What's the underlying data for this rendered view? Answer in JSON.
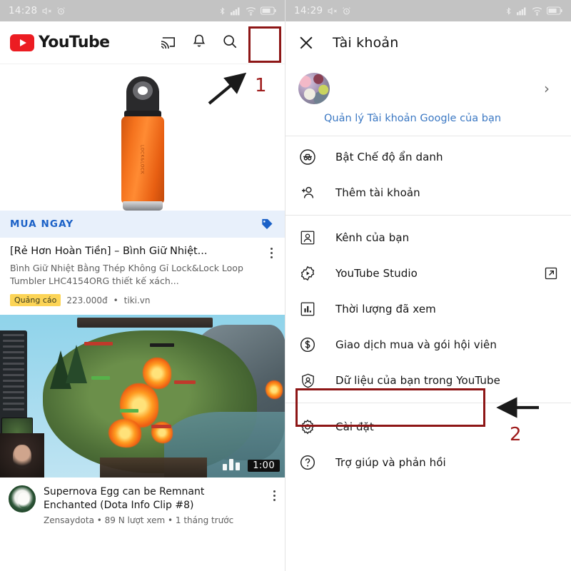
{
  "left_phone": {
    "status_bar": {
      "time": "14:28",
      "icons": [
        "mute-icon",
        "alarm-icon",
        "bluetooth-icon",
        "signal-icon",
        "wifi-icon",
        "battery-icon"
      ]
    },
    "app_bar": {
      "brand": "YouTube",
      "actions": [
        "cast-icon",
        "bell-icon",
        "search-icon",
        "account-avatar"
      ]
    },
    "ad_card": {
      "buy_label": "MUA NGAY",
      "tag_icon": "price-tag-icon",
      "title": "[Rẻ Hơn Hoàn Tiền] – Bình Giữ Nhiệt...",
      "description": "Bình Giữ Nhiệt Bằng Thép Không Gỉ Lock&Lock Loop Tumbler LHC4154ORG thiết kế xách...",
      "ad_badge": "Quảng cáo",
      "price": "223.000đ",
      "source": "tiki.vn",
      "separator": "•",
      "product_image": "orange-thermos-bottle"
    },
    "video_card": {
      "duration": "1:00",
      "thumbnail": "dota2-gameplay-thumbnail",
      "title": "Supernova Egg can be Remnant Enchanted (Dota Info Clip #8)",
      "channel": "Zensaydota",
      "views": "89 N lượt xem",
      "age": "1 tháng trước",
      "separator": "•"
    }
  },
  "right_phone": {
    "status_bar": {
      "time": "14:29",
      "icons": [
        "mute-icon",
        "alarm-icon",
        "bluetooth-icon",
        "signal-icon",
        "wifi-icon",
        "battery-icon"
      ]
    },
    "sheet": {
      "close_icon": "close-icon",
      "title": "Tài khoản",
      "manage_link": "Quản lý Tài khoản Google của bạn",
      "chevron": "›",
      "account_name_blurred": "",
      "account_email_blurred": ""
    },
    "menu_items": [
      {
        "label": "Bật Chế độ ẩn danh",
        "icon": "incognito-icon",
        "trailing": ""
      },
      {
        "label": "Thêm tài khoản",
        "icon": "add-person-icon",
        "trailing": ""
      },
      {
        "label": "Kênh của bạn",
        "icon": "channel-icon",
        "trailing": ""
      },
      {
        "label": "YouTube Studio",
        "icon": "studio-gear-icon",
        "trailing": "external-link-icon"
      },
      {
        "label": "Thời lượng đã xem",
        "icon": "bar-chart-icon",
        "trailing": ""
      },
      {
        "label": "Giao dịch mua và gói hội viên",
        "icon": "dollar-circle-icon",
        "trailing": ""
      },
      {
        "label": "Dữ liệu của bạn trong YouTube",
        "icon": "shield-person-icon",
        "trailing": ""
      },
      {
        "label": "Cài đặt",
        "icon": "gear-icon",
        "trailing": ""
      },
      {
        "label": "Trợ giúp và phản hồi",
        "icon": "help-circle-icon",
        "trailing": ""
      }
    ]
  },
  "annotations": {
    "step_one": "1",
    "step_two": "2",
    "highlight_color": "#8d1616",
    "number_color": "#9e1b1b",
    "arrow_color": "#1a1a1a"
  }
}
